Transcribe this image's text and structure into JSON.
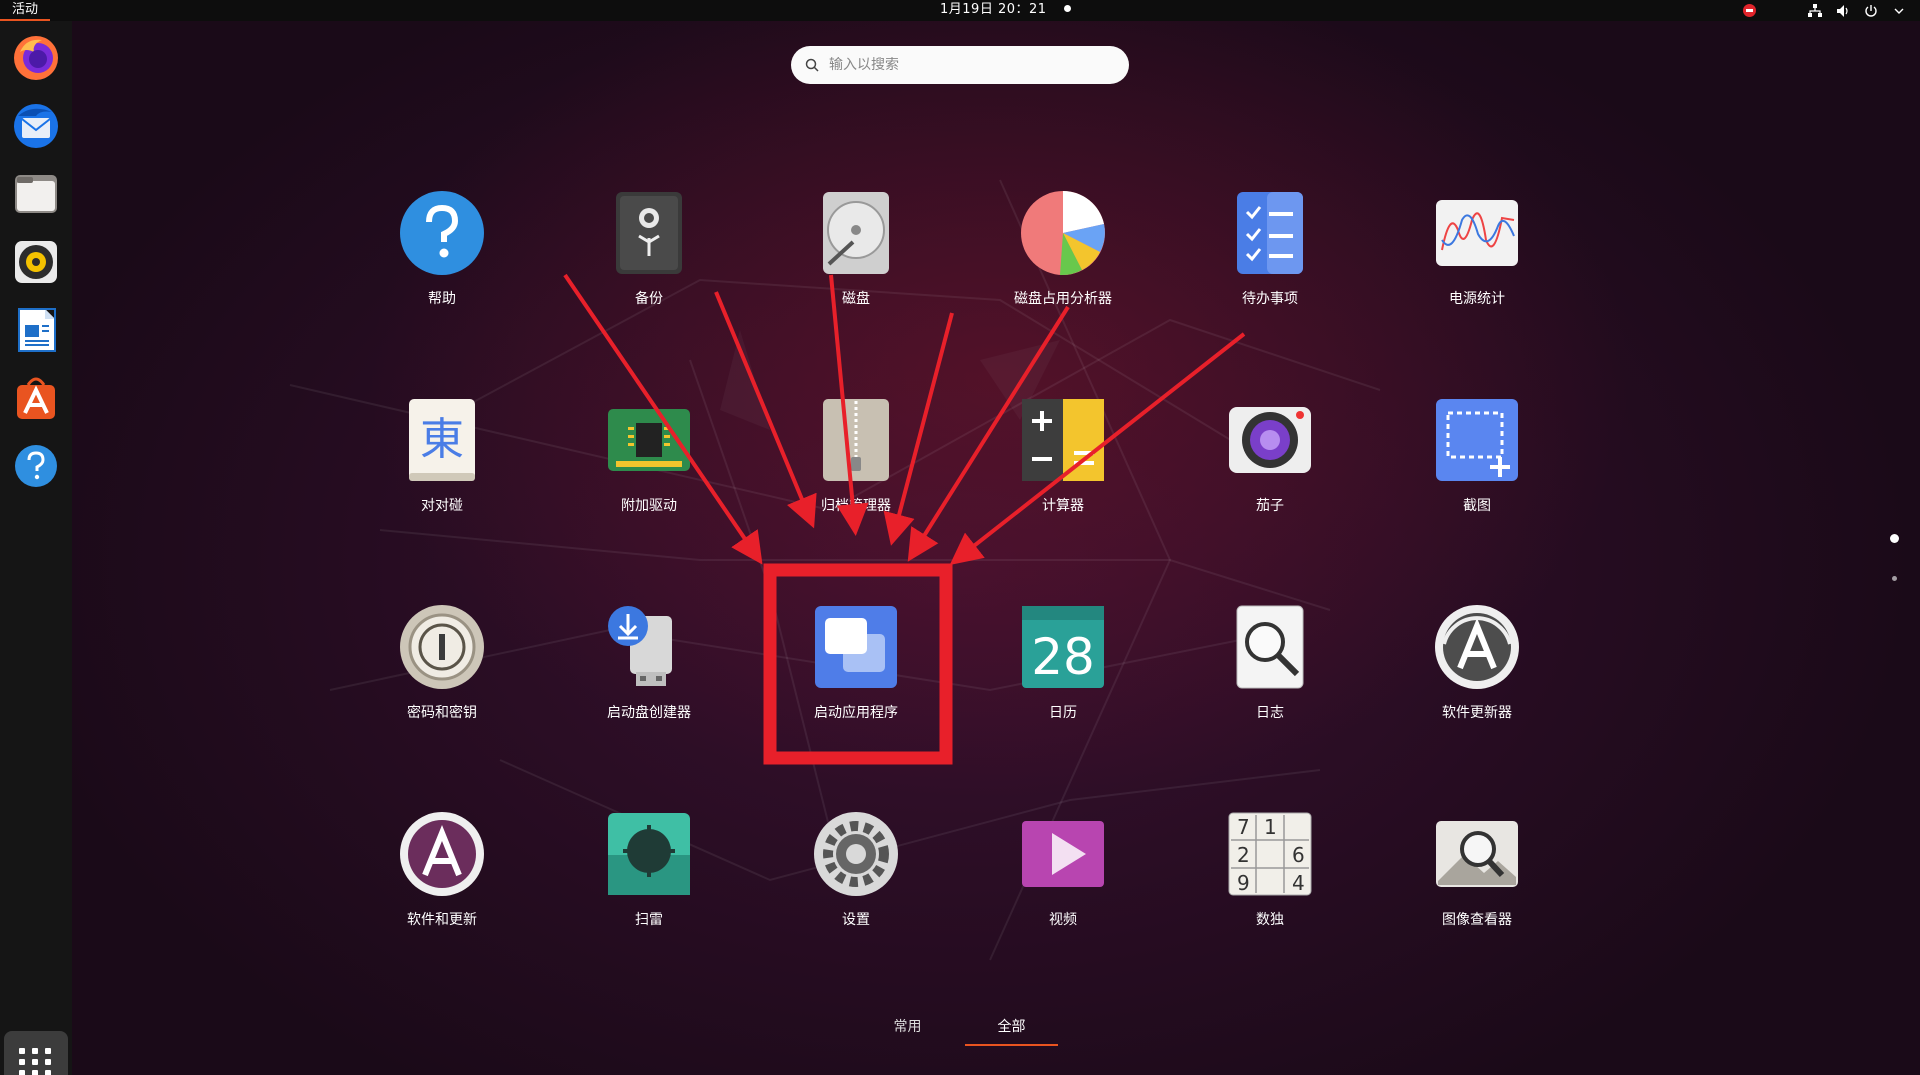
{
  "topbar": {
    "activities": "活动",
    "clock": "1月19日  20：21",
    "tray_icons": [
      "do-not-disturb-icon",
      "network-icon",
      "volume-icon",
      "power-icon"
    ]
  },
  "dock": {
    "items": [
      "firefox-icon",
      "thunderbird-icon",
      "files-icon",
      "rhythmbox-icon",
      "libreoffice-writer-icon",
      "software-center-icon",
      "help-icon"
    ],
    "show_apps": "show-applications-icon"
  },
  "search": {
    "placeholder": "输入以搜索"
  },
  "apps": [
    {
      "label": "帮助",
      "icon": "help-icon"
    },
    {
      "label": "备份",
      "icon": "backup-icon"
    },
    {
      "label": "磁盘",
      "icon": "disks-icon"
    },
    {
      "label": "磁盘占用分析器",
      "icon": "disk-usage-analyzer-icon"
    },
    {
      "label": "待办事项",
      "icon": "todo-icon"
    },
    {
      "label": "电源统计",
      "icon": "power-statistics-icon"
    },
    {
      "label": "对对碰",
      "icon": "mahjongg-icon"
    },
    {
      "label": "附加驱动",
      "icon": "additional-drivers-icon"
    },
    {
      "label": "归档管理器",
      "icon": "archive-manager-icon"
    },
    {
      "label": "计算器",
      "icon": "calculator-icon"
    },
    {
      "label": "茄子",
      "icon": "cheese-icon"
    },
    {
      "label": "截图",
      "icon": "screenshot-icon"
    },
    {
      "label": "密码和密钥",
      "icon": "passwords-keys-icon"
    },
    {
      "label": "启动盘创建器",
      "icon": "startup-disk-creator-icon"
    },
    {
      "label": "启动应用程序",
      "icon": "startup-applications-icon"
    },
    {
      "label": "日历",
      "icon": "calendar-icon"
    },
    {
      "label": "日志",
      "icon": "logs-icon"
    },
    {
      "label": "软件更新器",
      "icon": "software-updater-icon"
    },
    {
      "label": "软件和更新",
      "icon": "software-properties-icon"
    },
    {
      "label": "扫雷",
      "icon": "mines-icon"
    },
    {
      "label": "设置",
      "icon": "settings-icon"
    },
    {
      "label": "视频",
      "icon": "videos-icon"
    },
    {
      "label": "数独",
      "icon": "sudoku-icon"
    },
    {
      "label": "图像查看器",
      "icon": "image-viewer-icon"
    }
  ],
  "calendar_day": "28",
  "sudoku_digits": [
    "7",
    "1",
    "",
    "2",
    "",
    "6",
    "9",
    "",
    "4"
  ],
  "tabs": {
    "frequent": "常用",
    "all": "全部",
    "active": "all"
  },
  "highlight": {
    "target": "启动应用程序",
    "color": "#e8202a"
  },
  "colors": {
    "accent": "#e95420",
    "annotation": "#e8202a"
  }
}
